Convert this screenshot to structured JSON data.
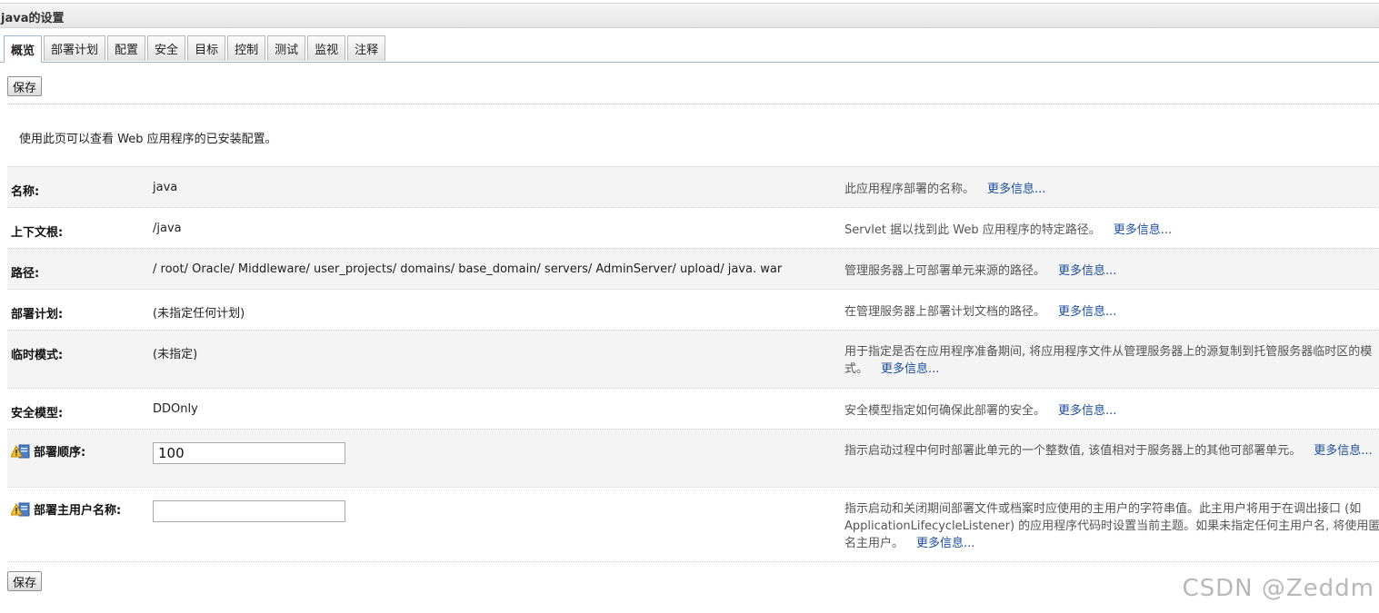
{
  "title": "java的设置",
  "tabs": [
    {
      "label": "概览",
      "active": true
    },
    {
      "label": "部署计划",
      "active": false
    },
    {
      "label": "配置",
      "active": false
    },
    {
      "label": "安全",
      "active": false
    },
    {
      "label": "目标",
      "active": false
    },
    {
      "label": "控制",
      "active": false
    },
    {
      "label": "测试",
      "active": false
    },
    {
      "label": "监视",
      "active": false
    },
    {
      "label": "注释",
      "active": false
    }
  ],
  "save_label": "保存",
  "intro": "使用此页可以查看 Web 应用程序的已安装配置。",
  "more_label": "更多信息...",
  "rows": [
    {
      "label": "名称:",
      "value": "java",
      "desc": "此应用程序部署的名称。"
    },
    {
      "label": "上下文根:",
      "value": "/java",
      "desc": "Servlet 据以找到此 Web 应用程序的特定路径。"
    },
    {
      "label": "路径:",
      "value": "/ root/ Oracle/ Middleware/ user_projects/ domains/ base_domain/ servers/ AdminServer/ upload/ java. war",
      "desc": "管理服务器上可部署单元来源的路径。"
    },
    {
      "label": "部署计划:",
      "value": "(未指定任何计划)",
      "desc": "在管理服务器上部署计划文档的路径。"
    },
    {
      "label": "临时模式:",
      "value": "(未指定)",
      "desc": "用于指定是否在应用程序准备期间, 将应用程序文件从管理服务器上的源复制到托管服务器临时区的模式。"
    },
    {
      "label": "安全模型:",
      "value": "DDOnly",
      "desc": "安全模型指定如何确保此部署的安全。"
    },
    {
      "label": "部署顺序:",
      "value": "100",
      "desc": "指示启动过程中何时部署此单元的一个整数值, 该值相对于服务器上的其他可部署单元。"
    },
    {
      "label": "部署主用户名称:",
      "value": "",
      "desc": "指示启动和关闭期间部署文件或档案时应使用的主用户的字符串值。此主用户将用于在调出接口 (如 ApplicationLifecycleListener) 的应用程序代码时设置当前主题。如果未指定任何主用户名, 将使用匿名主用户。"
    }
  ],
  "watermark": "CSDN @Zeddm",
  "colors": {
    "link": "#1a4e9e",
    "tab_border": "#9fb6cc",
    "row_shade": "#f4f4f4"
  }
}
